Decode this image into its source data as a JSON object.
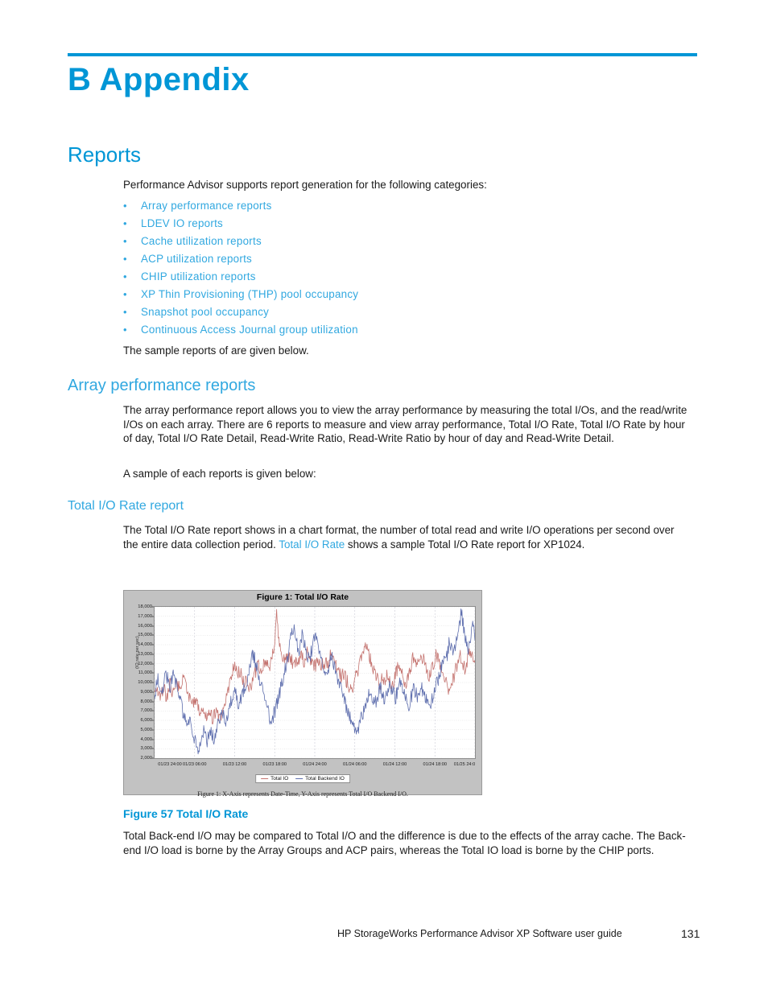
{
  "document": {
    "chapter_title": "B Appendix",
    "footer_text": "HP StorageWorks Performance Advisor XP Software user guide",
    "page_number": "131",
    "accent_color": "#0096d6",
    "link_color": "#31a8e0"
  },
  "sections": {
    "reports_heading": "Reports",
    "reports_intro": "Performance Advisor supports report generation for the following categories:",
    "report_categories": [
      "Array performance reports",
      "LDEV IO reports",
      "Cache utilization reports",
      "ACP utilization reports",
      "CHIP utilization reports",
      "XP Thin Provisioning (THP) pool occupancy",
      "Snapshot pool occupancy",
      "Continuous Access Journal group utilization"
    ],
    "sample_note": "The sample reports of are given below.",
    "array_heading": "Array performance reports",
    "array_body": "The array performance report allows you to view the array performance by measuring the total I/Os, and the read/write I/Os on each array.  There are 6 reports to measure and view array performance, Total I/O Rate, Total I/O Rate by hour of day, Total I/O Rate Detail, Read-Write Ratio, Read-Write Ratio by hour of day and Read-Write Detail.",
    "array_sample_note": "A sample of each reports is given below:",
    "total_io_heading": "Total I/O Rate report",
    "total_io_body_part1": "The Total I/O Rate report shows in a chart format, the number of total read and write I/O operations per second over the entire data collection period. ",
    "total_io_link": "Total I/O Rate",
    "total_io_body_part2": " shows a sample Total I/O Rate report for XP1024.",
    "figure_caption": "Figure 57 Total I/O Rate",
    "backend_body": "Total Back-end I/O may be compared to Total I/O and the difference is due to the effects of the array cache.  The Back-end I/O load is borne by the Array Groups and ACP pairs, whereas the Total IO load is borne by the CHIP ports."
  },
  "figure": {
    "note": "Figure 1: X-Axis represents Date-Time, Y-Axis represents Total I/O Backend I/O.",
    "background_color": "#c2c2c2"
  },
  "chart_data": {
    "type": "line",
    "title": "Figure 1: Total I/O Rate",
    "xlabel": "",
    "ylabel": "(IO rate per sec)",
    "ylim": [
      2000,
      18000
    ],
    "grid": true,
    "legend_position": "bottom",
    "ytick_labels": [
      "18,000",
      "17,000",
      "16,000",
      "15,000",
      "14,000",
      "13,000",
      "12,000",
      "11,000",
      "10,000",
      "9,000",
      "8,000",
      "7,000",
      "6,000",
      "5,000",
      "4,000",
      "3,000",
      "2,000"
    ],
    "ytick_values": [
      18000,
      17000,
      16000,
      15000,
      14000,
      13000,
      12000,
      11000,
      10000,
      9000,
      8000,
      7000,
      6000,
      5000,
      4000,
      3000,
      2000
    ],
    "xtick_labels": [
      "01/23 24:00",
      "01/23 06:00",
      "01/23 12:00",
      "01/23 18:00",
      "01/24 24:00",
      "01/24 06:00",
      "01/24 12:00",
      "01/24 18:00",
      "01/25 24:0"
    ],
    "series": [
      {
        "name": "Total IO",
        "color": "#c4736f",
        "values": [
          8600,
          9300,
          8900,
          8300,
          8700,
          9600,
          9100,
          8500,
          9000,
          9800,
          9400,
          8800,
          9500,
          10100,
          9600,
          9000,
          9700,
          10300,
          9700,
          9100,
          8600,
          8000,
          7500,
          7900,
          8400,
          7800,
          7200,
          6800,
          7300,
          6900,
          6400,
          6800,
          7200,
          6700,
          6200,
          6600,
          7000,
          6500,
          6100,
          6500,
          7000,
          7600,
          8200,
          8900,
          9600,
          10400,
          11200,
          11900,
          11400,
          10800,
          11300,
          10900,
          10400,
          9900,
          10300,
          9800,
          9300,
          9700,
          10200,
          10800,
          11400,
          12000,
          11500,
          11000,
          11600,
          12200,
          11700,
          12300,
          11900,
          12600,
          13400,
          14800,
          17200,
          15400,
          13600,
          12900,
          12400,
          12900,
          12500,
          12100,
          12600,
          12200,
          11800,
          12300,
          11900,
          12500,
          13000,
          12600,
          12200,
          12700,
          13200,
          12800,
          12400,
          11900,
          11500,
          11900,
          12400,
          12000,
          11600,
          12100,
          11700,
          12300,
          11900,
          12500,
          13100,
          12700,
          12200,
          11800,
          11400,
          11000,
          10600,
          11100,
          10700,
          10300,
          9900,
          9500,
          9100,
          9600,
          10200,
          10800,
          11400,
          12100,
          12800,
          13500,
          14000,
          13600,
          13100,
          12600,
          12100,
          11600,
          11100,
          10600,
          10100,
          9700,
          10200,
          9800,
          10400,
          11000,
          10500,
          10000,
          9600,
          10100,
          10700,
          11300,
          11900,
          11400,
          10900,
          10400,
          9900,
          10400,
          11000,
          11600,
          12300,
          13000,
          12500,
          12000,
          12600,
          13200,
          12700,
          12200,
          11700,
          11200,
          10700,
          11200,
          11800,
          12400,
          13000,
          12500,
          12000,
          11500,
          11000,
          10500,
          10000,
          9500,
          9000,
          9600,
          10200,
          10900,
          11600,
          12300,
          13000,
          12500,
          12000,
          11500,
          12100,
          12700,
          13300,
          12800,
          12300,
          11800
        ]
      },
      {
        "name": "Total Backend IO",
        "color": "#5f6fae",
        "values": [
          8700,
          9600,
          10300,
          9500,
          8800,
          9600,
          10400,
          10900,
          10100,
          9400,
          10200,
          11200,
          10300,
          9500,
          8800,
          8100,
          7400,
          6800,
          6200,
          5700,
          6200,
          5600,
          5000,
          4500,
          4000,
          3500,
          3000,
          3600,
          4200,
          4800,
          4300,
          3800,
          4400,
          5000,
          4600,
          4100,
          4700,
          5300,
          5900,
          6500,
          7100,
          6600,
          6100,
          6700,
          7300,
          7900,
          8500,
          9100,
          8600,
          8100,
          7600,
          8200,
          8800,
          9400,
          10000,
          10700,
          11400,
          12200,
          13100,
          12500,
          11800,
          11100,
          10400,
          9700,
          9000,
          8300,
          7600,
          6900,
          6200,
          5600,
          6300,
          7000,
          7700,
          8400,
          9100,
          9800,
          10600,
          11400,
          12300,
          13200,
          14200,
          15300,
          15800,
          14900,
          14000,
          13200,
          14100,
          15000,
          14400,
          13700,
          13000,
          12300,
          13000,
          13700,
          14400,
          15100,
          14400,
          13600,
          12800,
          12000,
          11200,
          10500,
          11200,
          12000,
          12800,
          12300,
          11700,
          11100,
          10500,
          9900,
          9300,
          8700,
          8100,
          7500,
          7000,
          6500,
          6000,
          5500,
          5100,
          4700,
          5200,
          5700,
          6200,
          6800,
          7400,
          8000,
          8600,
          9200,
          8700,
          8200,
          7700,
          8300,
          8900,
          9500,
          9000,
          8500,
          8000,
          8600,
          9200,
          9800,
          9300,
          8800,
          8300,
          8900,
          9500,
          10100,
          9600,
          9100,
          8600,
          8100,
          7600,
          8200,
          8800,
          9400,
          8900,
          8400,
          9000,
          9600,
          9100,
          8600,
          8200,
          7700,
          7200,
          7800,
          8400,
          9000,
          9600,
          10200,
          10800,
          11500,
          12300,
          13100,
          12400,
          13200,
          14500,
          13700,
          12900,
          13600,
          14300,
          15100,
          16000,
          17600,
          16200,
          15100,
          14300,
          13500,
          14400,
          15300,
          16200,
          14800
        ]
      }
    ]
  }
}
